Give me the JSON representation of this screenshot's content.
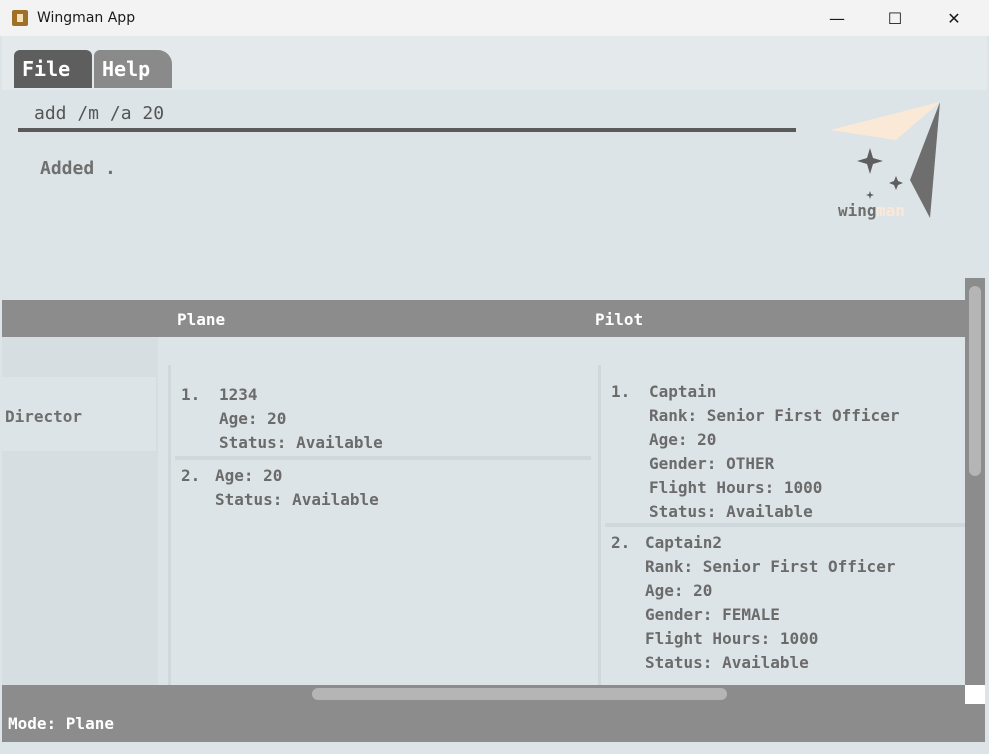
{
  "window": {
    "title": "Wingman App",
    "minimize": "—",
    "maximize": "☐",
    "close": "✕"
  },
  "menu": {
    "file": "File",
    "help": "Help"
  },
  "command": {
    "value": "add /m /a 20",
    "result": "Added ."
  },
  "logo": {
    "text_part1": "wing",
    "text_part2": "man"
  },
  "columns": {
    "plane": "Plane",
    "pilot": "Pilot",
    "director": "Director"
  },
  "planes": [
    {
      "index": "1.",
      "name": "1234",
      "age": "Age: 20",
      "status": "Status: Available"
    },
    {
      "index": "2.",
      "name": "",
      "age": "Age: 20",
      "status": "Status: Available"
    }
  ],
  "pilots": [
    {
      "index": "1.",
      "name": "Captain",
      "rank": "Rank: Senior First Officer",
      "age": "Age: 20",
      "gender": "Gender: OTHER",
      "hours": "Flight Hours: 1000",
      "status": "Status: Available"
    },
    {
      "index": "2.",
      "name": "Captain2",
      "rank": "Rank: Senior First Officer",
      "age": "Age: 20",
      "gender": "Gender: FEMALE",
      "hours": "Flight Hours: 1000",
      "status": "Status: Available"
    }
  ],
  "status_bar": {
    "mode": "Mode: Plane"
  },
  "colors": {
    "header_gray": "#8c8c8c",
    "background": "#dde4e7",
    "logo_cream": "#fbe9d7",
    "logo_dark": "#6e6e6e"
  }
}
